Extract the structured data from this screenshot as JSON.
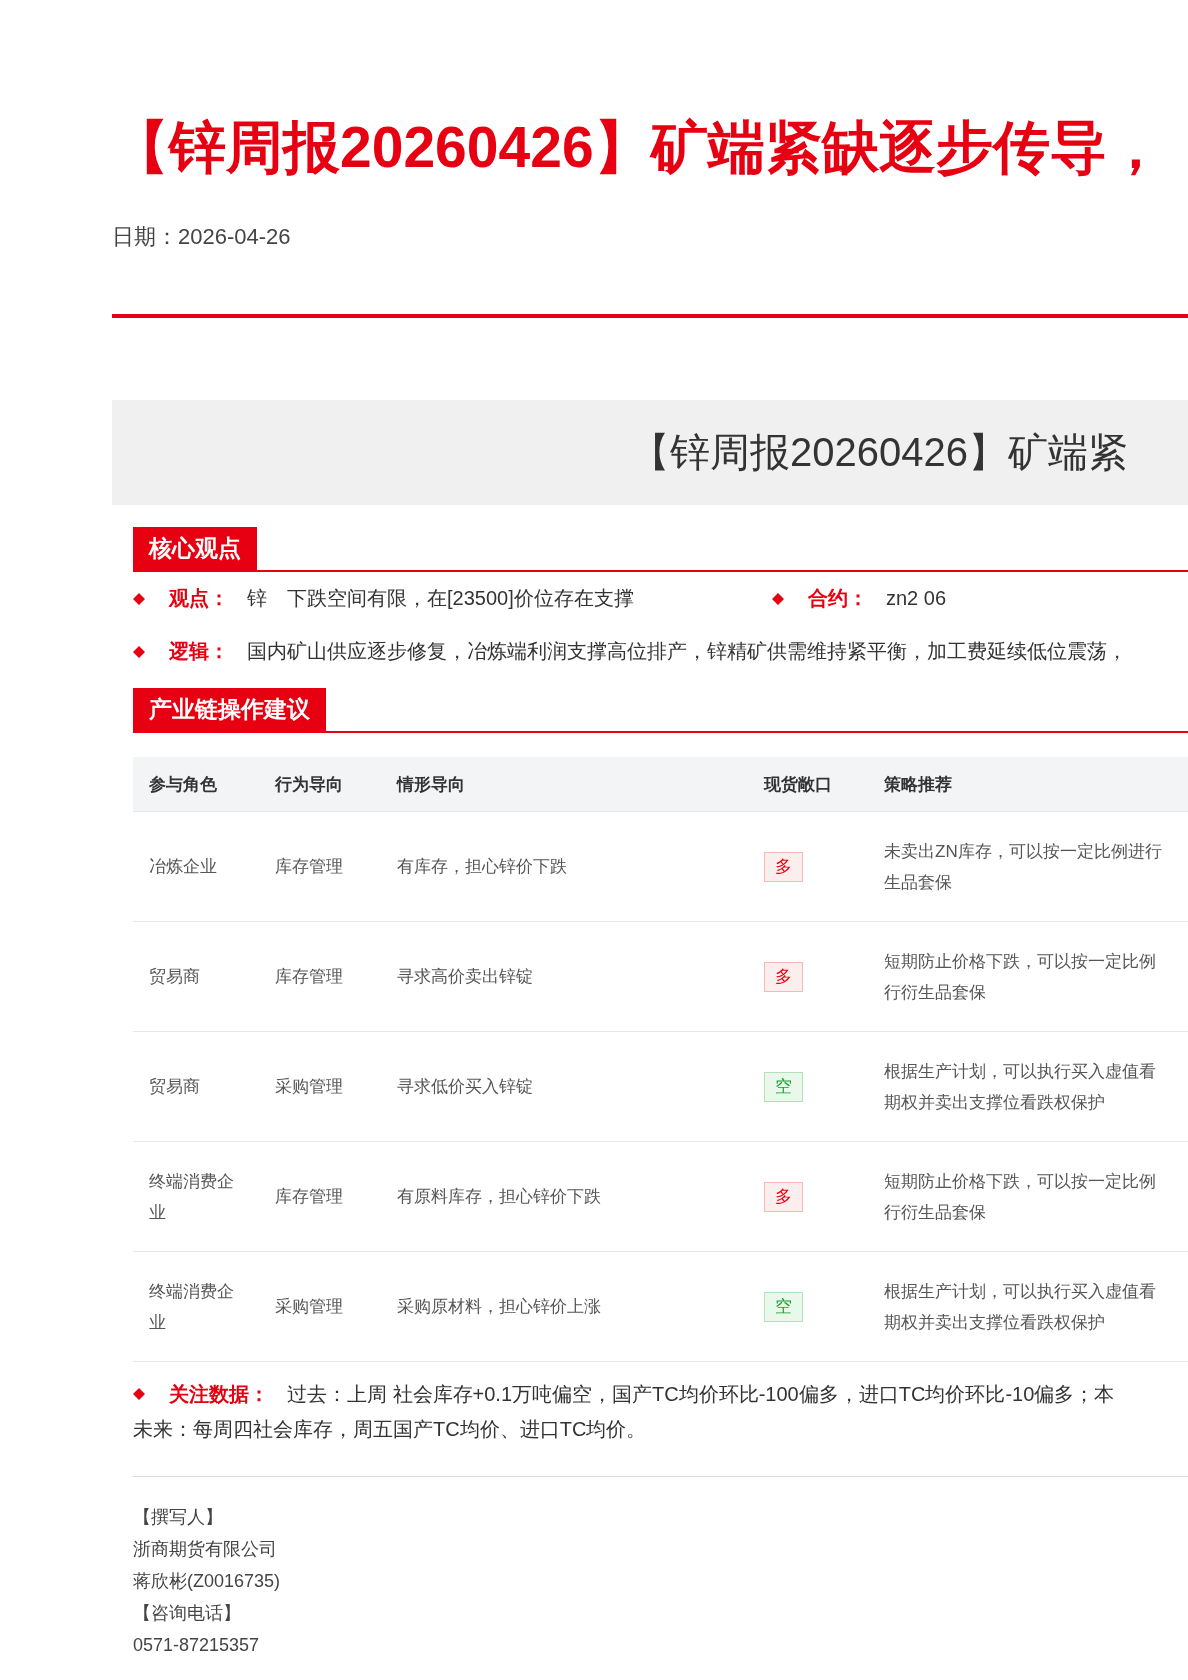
{
  "article": {
    "title": "【锌周报20260426】矿端紧缺逐步传导，",
    "date": "日期：2026-04-26"
  },
  "banner": {
    "title": "【锌周报20260426】矿端紧"
  },
  "core_view": {
    "heading": "核心观点",
    "items": [
      {
        "label": "观点：",
        "text": "锌　下跌空间有限，在[23500]价位存在支撑",
        "extra_label": "合约：",
        "extra_text": "zn2 06"
      },
      {
        "label": "逻辑：",
        "text": "国内矿山供应逐步修复，冶炼端利润支撑高位排产，锌精矿供需维持紧平衡，加工费延续低位震荡，"
      }
    ]
  },
  "advice": {
    "heading": "产业链操作建议",
    "table": {
      "columns": [
        "参与角色",
        "行为导向",
        "情形导向",
        "现货敞口",
        "策略推荐"
      ],
      "rows": [
        {
          "role": [
            "冶炼企业"
          ],
          "behavior": "库存管理",
          "situation": "有库存，担心锌价下跌",
          "exposure": {
            "kind": "long",
            "label": "多"
          },
          "strategy": [
            "未卖出ZN库存，可以按一定比例进行",
            "生品套保"
          ]
        },
        {
          "role": [
            "贸易商"
          ],
          "behavior": "库存管理",
          "situation": "寻求高价卖出锌锭",
          "exposure": {
            "kind": "long",
            "label": "多"
          },
          "strategy": [
            "短期防止价格下跌，可以按一定比例",
            "行衍生品套保"
          ]
        },
        {
          "role": [
            "贸易商"
          ],
          "behavior": "采购管理",
          "situation": "寻求低价买入锌锭",
          "exposure": {
            "kind": "short",
            "label": "空"
          },
          "strategy": [
            "根据生产计划，可以执行买入虚值看",
            "期权并卖出支撑位看跌权保护"
          ]
        },
        {
          "role": [
            "终端消费企",
            "业"
          ],
          "behavior": "库存管理",
          "situation": "有原料库存，担心锌价下跌",
          "exposure": {
            "kind": "long",
            "label": "多"
          },
          "strategy": [
            "短期防止价格下跌，可以按一定比例",
            "行衍生品套保"
          ]
        },
        {
          "role": [
            "终端消费企",
            "业"
          ],
          "behavior": "采购管理",
          "situation": "采购原材料，担心锌价上涨",
          "exposure": {
            "kind": "short",
            "label": "空"
          },
          "strategy": [
            "根据生产计划，可以执行买入虚值看",
            "期权并卖出支撑位看跌权保护"
          ]
        }
      ]
    }
  },
  "key_data": {
    "label": "关注数据：",
    "past": "过去：上周 社会库存+0.1万吨偏空，国产TC均价环比-100偏多，进口TC均价环比-10偏多；本",
    "future": "未来：每周四社会库存，周五国产TC均价、进口TC均价。"
  },
  "contact": [
    "【撰写人】",
    "浙商期货有限公司",
    "蒋欣彬(Z0016735)",
    "【咨询电话】",
    "0571-87215357"
  ]
}
